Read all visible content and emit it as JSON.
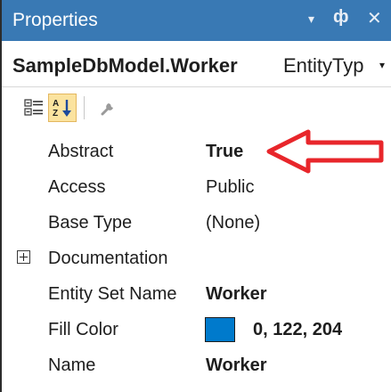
{
  "window": {
    "title": "Properties",
    "dropdown_glyph": "▾",
    "pin_glyph": "ф",
    "close_glyph": "✕"
  },
  "object_selector": {
    "name": "SampleDbModel.Worker",
    "type": "EntityTyp",
    "dropdown_glyph": "▾"
  },
  "toolbar": {
    "icons": [
      "categorized-icon",
      "alphabetical-icon",
      "property-pages-icon"
    ],
    "alphabetical_selected": true
  },
  "properties": [
    {
      "name": "Abstract",
      "value": "True",
      "bold": true
    },
    {
      "name": "Access",
      "value": "Public",
      "bold": false
    },
    {
      "name": "Base Type",
      "value": "(None)",
      "bold": false
    },
    {
      "name": "Documentation",
      "value": "",
      "expandable": true
    },
    {
      "name": "Entity Set Name",
      "value": "Worker",
      "bold": true
    },
    {
      "name": "Fill Color",
      "value": "0, 122, 204",
      "bold": true,
      "swatch": "#007acc"
    },
    {
      "name": "Name",
      "value": "Worker",
      "bold": true
    }
  ],
  "colors": {
    "titlebar": "#3979b4",
    "annotation_arrow": "#e8262b",
    "selected_tool": "#fbe39f"
  }
}
